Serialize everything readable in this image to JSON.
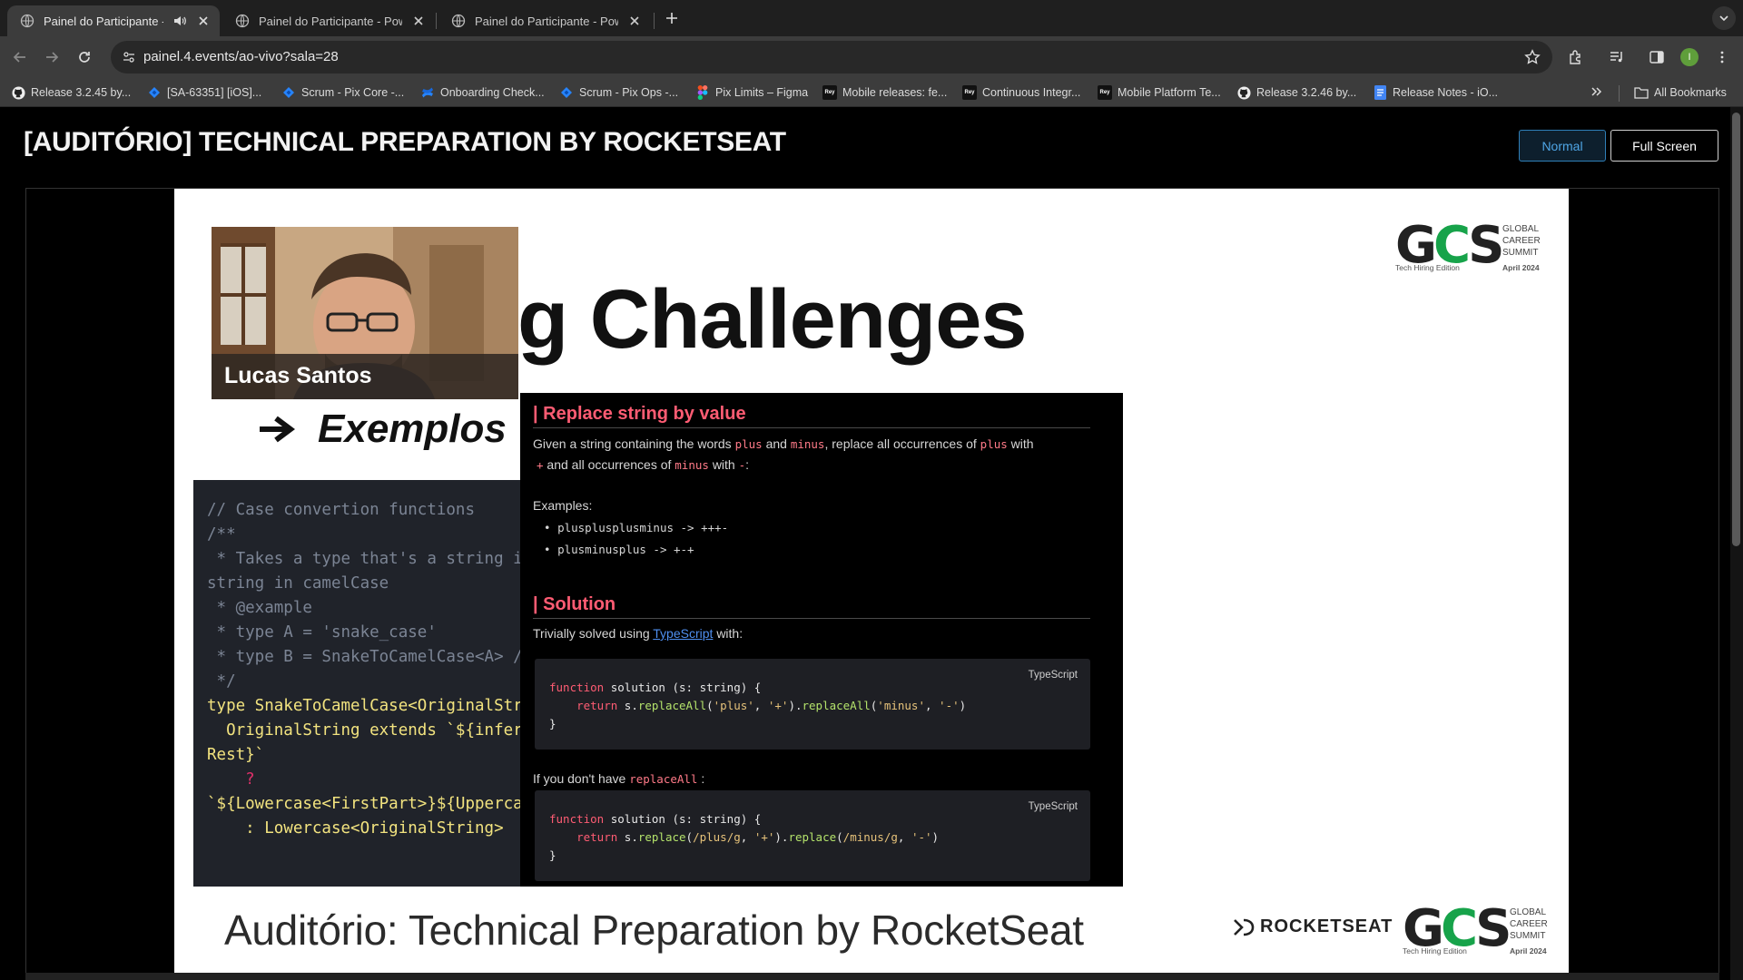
{
  "browser": {
    "tabs": [
      {
        "title": "Painel do Participante - Pi",
        "active": true,
        "audio": true
      },
      {
        "title": "Painel do Participante - Powe",
        "active": false,
        "audio": false
      },
      {
        "title": "Painel do Participante - Powe",
        "active": false,
        "audio": false
      }
    ],
    "url": "painel.4.events/ao-vivo?sala=28",
    "avatar_letter": "I",
    "bookmarks": [
      {
        "label": "Release 3.2.45 by...",
        "icon": "github-icon"
      },
      {
        "label": "[SA-63351] [iOS]...",
        "icon": "jira-icon"
      },
      {
        "label": "Scrum - Pix Core -...",
        "icon": "jira-icon"
      },
      {
        "label": "Onboarding Check...",
        "icon": "confluence-icon"
      },
      {
        "label": "Scrum - Pix Ops -...",
        "icon": "jira-icon"
      },
      {
        "label": "Pix Limits – Figma",
        "icon": "figma-icon"
      },
      {
        "label": "Mobile releases: fe...",
        "icon": "box-icon"
      },
      {
        "label": "Continuous Integr...",
        "icon": "box-icon"
      },
      {
        "label": "Mobile Platform Te...",
        "icon": "box-icon"
      },
      {
        "label": "Release 3.2.46 by...",
        "icon": "github-icon"
      },
      {
        "label": "Release Notes - iO...",
        "icon": "docs-icon"
      }
    ],
    "all_bookmarks_label": "All Bookmarks"
  },
  "page": {
    "title": "[AUDITÓRIO] TECHNICAL PREPARATION BY ROCKETSEAT",
    "normal_label": "Normal",
    "fullscreen_label": "Full Screen"
  },
  "slide": {
    "heading": "g Challenges",
    "exemplos": "Exemplos",
    "presenter_name": "Lucas Santos",
    "logo": {
      "mark": "GCS",
      "words": [
        "GLOBAL",
        "CAREER",
        "SUMMIT"
      ],
      "edition": "Tech Hiring Edition",
      "date": "April 2024"
    },
    "left_code": [
      "// Case convertion functions",
      "",
      "/**",
      " * Takes a type that's a string i",
      "string in camelCase",
      " * @example",
      " * type A = 'snake_case'",
      " * type B = SnakeToCamelCase<A> /",
      " */",
      "type SnakeToCamelCase<OriginalStr",
      "  OriginalString extends `${infer",
      "Rest}`",
      "    ?",
      "`${Lowercase<FirstPart>}${Upperca",
      "    : Lowercase<OriginalString>"
    ],
    "problem": {
      "title": "Replace string by value",
      "line1_a": "Given a string containing the words",
      "plus": "plus",
      "and": "and",
      "minus": "minus",
      "line1_b": ", replace all occurrences of",
      "line1_c": "with",
      "plus_sym": "+",
      "line2_a": "and all occurrences of",
      "line2_b": "with",
      "minus_sym": "-",
      "line2_end": ":",
      "examples_label": "Examples:",
      "examples": [
        "plusplusplusminus -> +++-",
        "plusminusplus -> +-+"
      ],
      "solution_title": "Solution",
      "solution_text": "Trivially solved using",
      "solution_link": "TypeScript",
      "solution_with": "with:",
      "lang_label": "TypeScript",
      "code1": [
        "function solution (s: string) {",
        "    return s.replaceAll('plus', '+').replaceAll('minus', '-')",
        "}"
      ],
      "no_replaceall_a": "If you don't have",
      "no_replaceall_code": "replaceAll",
      "no_replaceall_b": ":",
      "code2": [
        "function solution (s: string) {",
        "    return s.replace(/plus/g, '+').replace(/minus/g, '-')",
        "}"
      ]
    },
    "footer_title": "Auditório: Technical Preparation by RocketSeat",
    "rocketseat": "ROCKETSEAT"
  }
}
